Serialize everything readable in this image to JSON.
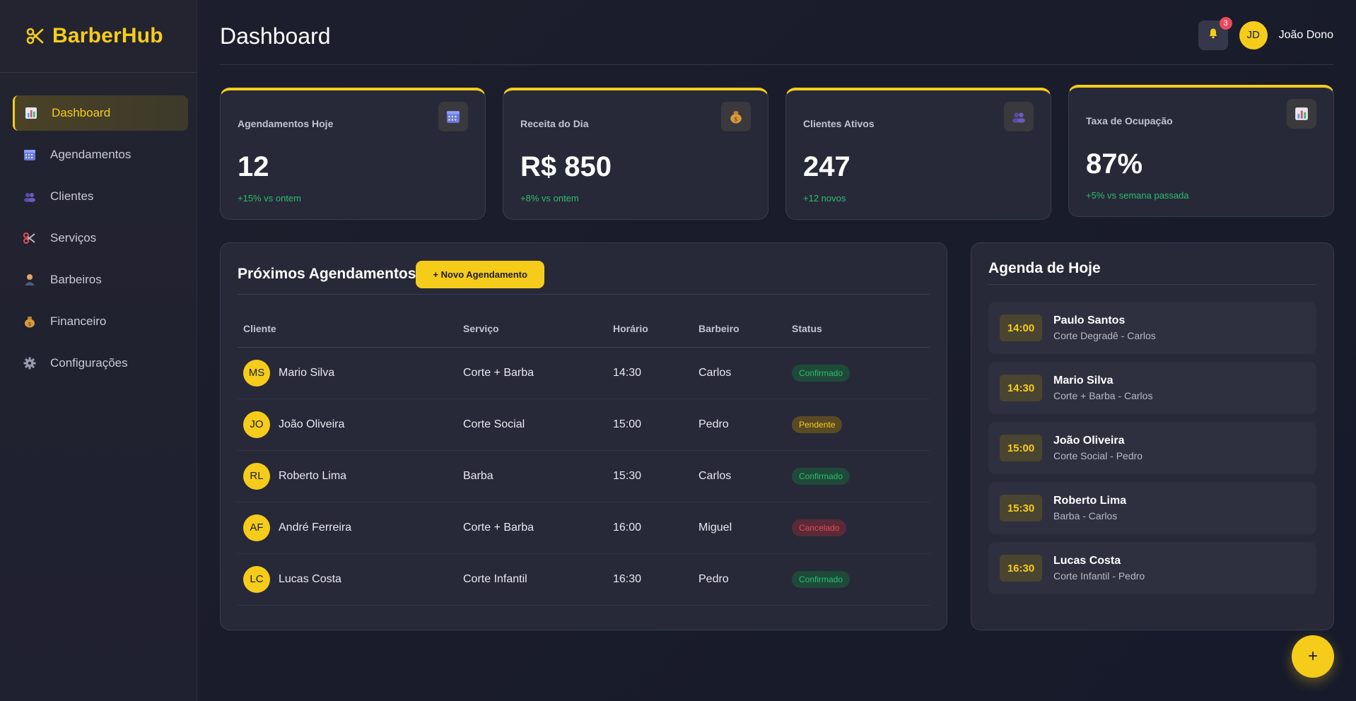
{
  "app": {
    "name": "BarberHub"
  },
  "sidebar": {
    "items": [
      {
        "label": "Dashboard",
        "icon": "chart-icon",
        "active": true
      },
      {
        "label": "Agendamentos",
        "icon": "calendar-icon"
      },
      {
        "label": "Clientes",
        "icon": "users-icon"
      },
      {
        "label": "Serviços",
        "icon": "scissors-icon"
      },
      {
        "label": "Barbeiros",
        "icon": "barber-icon"
      },
      {
        "label": "Financeiro",
        "icon": "money-bag-icon"
      },
      {
        "label": "Configurações",
        "icon": "gear-icon"
      }
    ]
  },
  "header": {
    "title": "Dashboard",
    "notifications": "3",
    "user_initials": "JD",
    "user_name": "João Dono"
  },
  "stats": [
    {
      "label": "Agendamentos Hoje",
      "value": "12",
      "change": "+15% vs ontem",
      "icon": "calendar-icon"
    },
    {
      "label": "Receita do Dia",
      "value": "R$ 850",
      "change": "+8% vs ontem",
      "icon": "money-bag-icon"
    },
    {
      "label": "Clientes Ativos",
      "value": "247",
      "change": "+12 novos",
      "icon": "users-icon"
    },
    {
      "label": "Taxa de Ocupação",
      "value": "87%",
      "change": "+5% vs semana passada",
      "icon": "chart-icon"
    }
  ],
  "appointments": {
    "title": "Próximos Agendamentos",
    "new_button": "+ Novo Agendamento",
    "columns": [
      "Cliente",
      "Serviço",
      "Horário",
      "Barbeiro",
      "Status"
    ],
    "rows": [
      {
        "initials": "MS",
        "client": "Mario Silva",
        "service": "Corte + Barba",
        "time": "14:30",
        "barber": "Carlos",
        "status": "Confirmado",
        "status_type": "ok"
      },
      {
        "initials": "JO",
        "client": "João Oliveira",
        "service": "Corte Social",
        "time": "15:00",
        "barber": "Pedro",
        "status": "Pendente",
        "status_type": "pend"
      },
      {
        "initials": "RL",
        "client": "Roberto Lima",
        "service": "Barba",
        "time": "15:30",
        "barber": "Carlos",
        "status": "Confirmado",
        "status_type": "ok"
      },
      {
        "initials": "AF",
        "client": "André Ferreira",
        "service": "Corte + Barba",
        "time": "16:00",
        "barber": "Miguel",
        "status": "Cancelado",
        "status_type": "cancel"
      },
      {
        "initials": "LC",
        "client": "Lucas Costa",
        "service": "Corte Infantil",
        "time": "16:30",
        "barber": "Pedro",
        "status": "Confirmado",
        "status_type": "ok"
      }
    ]
  },
  "agenda": {
    "title": "Agenda de Hoje",
    "items": [
      {
        "time": "14:00",
        "name": "Paulo Santos",
        "detail": "Corte Degradê - Carlos"
      },
      {
        "time": "14:30",
        "name": "Mario Silva",
        "detail": "Corte + Barba - Carlos"
      },
      {
        "time": "15:00",
        "name": "João Oliveira",
        "detail": "Corte Social - Pedro"
      },
      {
        "time": "15:30",
        "name": "Roberto Lima",
        "detail": "Barba - Carlos"
      },
      {
        "time": "16:30",
        "name": "Lucas Costa",
        "detail": "Corte Infantil - Pedro"
      }
    ]
  },
  "fab": {
    "label": "+"
  },
  "colors": {
    "accent": "#f6cc1b",
    "success": "#2ebd6b",
    "danger": "#e84a5a",
    "background": "#1d1f2e",
    "card": "#272939"
  }
}
